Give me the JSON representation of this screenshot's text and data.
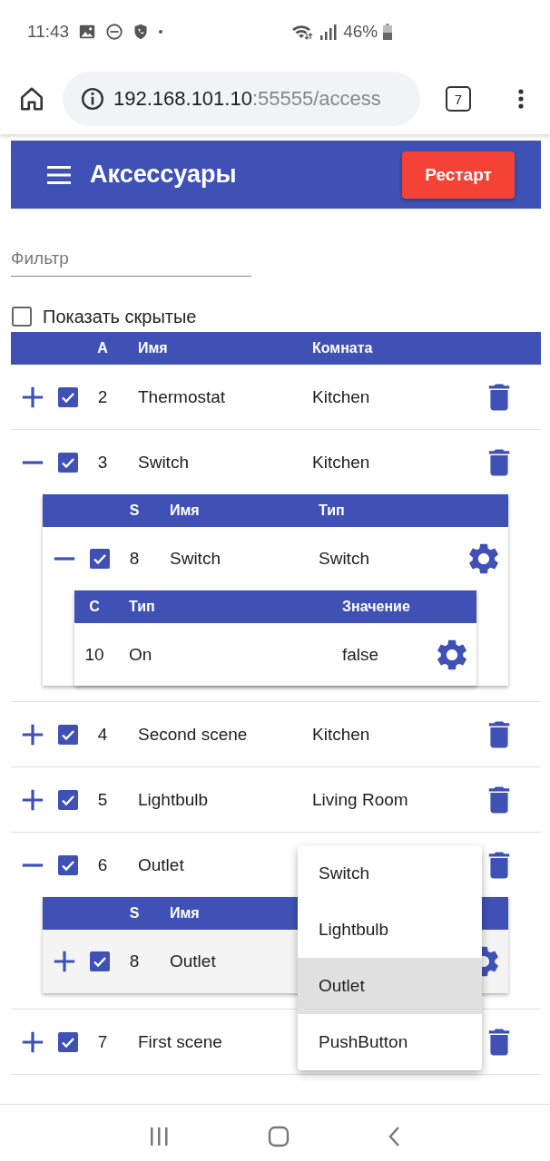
{
  "status_bar": {
    "time": "11:43",
    "battery": "46%"
  },
  "browser": {
    "url_host": "192.168.101.10",
    "url_rest": ":55555/access",
    "tab_count": "7"
  },
  "app_bar": {
    "title": "Аксессуары",
    "restart_button": "Рестарт"
  },
  "filter": {
    "placeholder": "Фильтр"
  },
  "show_hidden": {
    "label": "Показать скрытые",
    "checked": false
  },
  "table": {
    "columns": [
      "A",
      "Имя",
      "Комната"
    ],
    "rows": [
      {
        "id": "2",
        "name": "Thermostat",
        "room": "Kitchen",
        "enabled": true,
        "expanded": false
      },
      {
        "id": "3",
        "name": "Switch",
        "room": "Kitchen",
        "enabled": true,
        "expanded": true,
        "services": {
          "columns": [
            "S",
            "Имя",
            "Тип"
          ],
          "rows": [
            {
              "id": "8",
              "name": "Switch",
              "type": "Switch",
              "enabled": true,
              "expanded": true,
              "selected": false,
              "characteristics": {
                "columns": [
                  "C",
                  "Тип",
                  "Значение"
                ],
                "rows": [
                  {
                    "id": "10",
                    "type": "On",
                    "value": "false"
                  }
                ]
              }
            }
          ]
        }
      },
      {
        "id": "4",
        "name": "Second scene",
        "room": "Kitchen",
        "enabled": true,
        "expanded": false
      },
      {
        "id": "5",
        "name": "Lightbulb",
        "room": "Living Room",
        "enabled": true,
        "expanded": false
      },
      {
        "id": "6",
        "name": "Outlet",
        "enabled": true,
        "expanded": true,
        "services": {
          "columns": [
            "S",
            "Имя"
          ],
          "rows": [
            {
              "id": "8",
              "name": "Outlet",
              "enabled": true,
              "expanded": false,
              "selected": true
            }
          ]
        }
      },
      {
        "id": "7",
        "name": "First scene",
        "enabled": true,
        "expanded": false
      }
    ]
  },
  "dropdown": {
    "options": [
      {
        "label": "Switch",
        "selected": false
      },
      {
        "label": "Lightbulb",
        "selected": false
      },
      {
        "label": "Outlet",
        "selected": true
      },
      {
        "label": "PushButton",
        "selected": false
      }
    ]
  }
}
